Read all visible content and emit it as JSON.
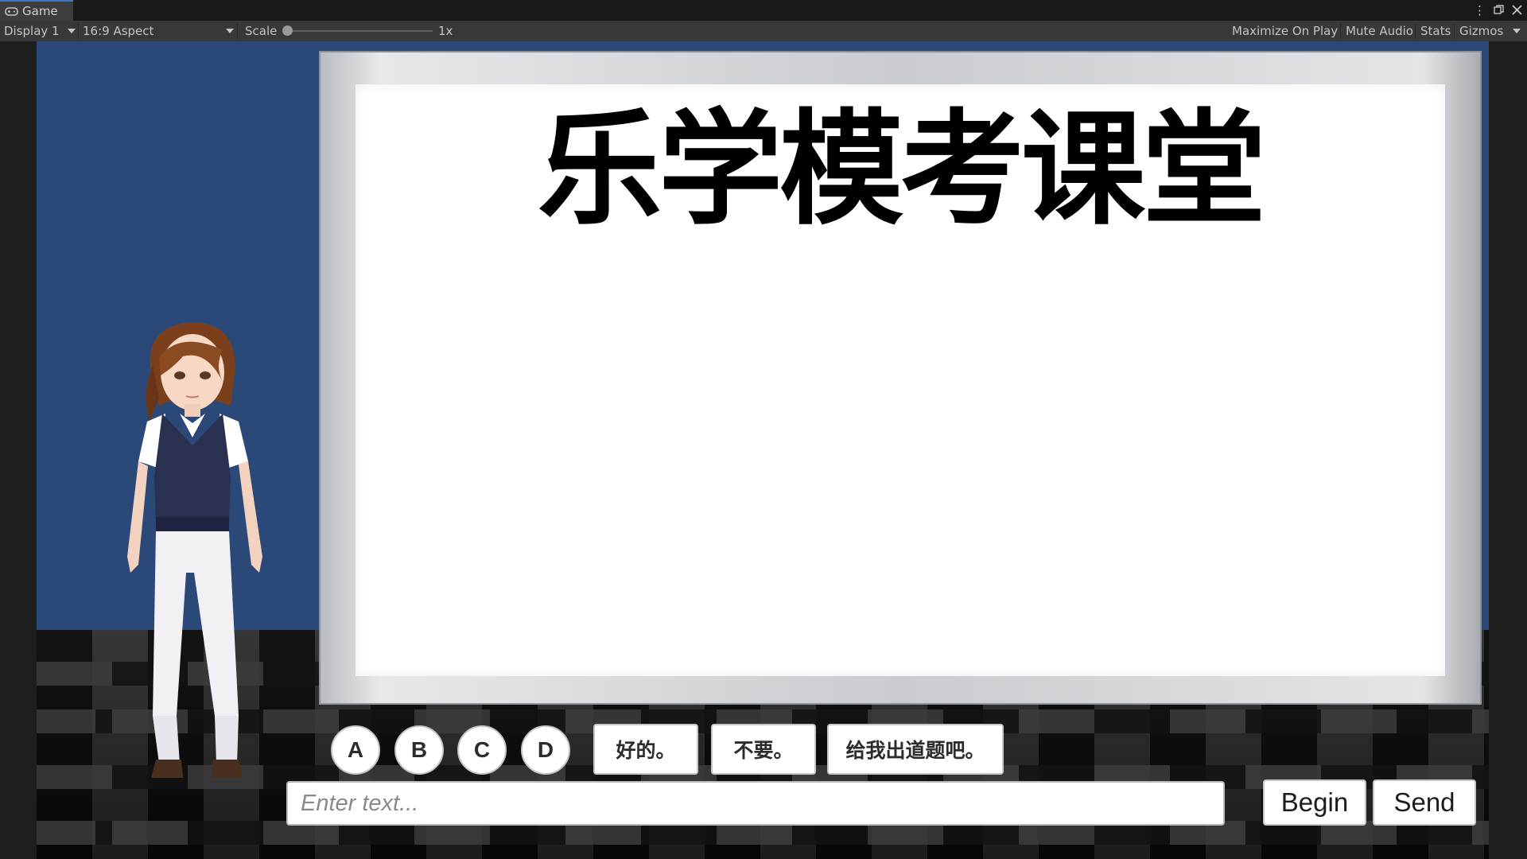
{
  "window": {
    "tab_title": "Game",
    "tab_icon": "gamepad-icon",
    "window_controls": [
      "kebab-menu-icon",
      "maximize-icon",
      "close-icon"
    ]
  },
  "toolbar": {
    "display": "Display 1",
    "aspect": "16:9 Aspect",
    "scale_label": "Scale",
    "scale_value": "1x",
    "maximize_on_play": "Maximize On Play",
    "mute_audio": "Mute Audio",
    "stats": "Stats",
    "gizmos": "Gizmos"
  },
  "scene": {
    "background_color": "#2b4978",
    "whiteboard_title": "乐学模考课堂"
  },
  "controls": {
    "answer_options": [
      "A",
      "B",
      "C",
      "D"
    ],
    "quick_replies": [
      "好的。",
      "不要。",
      "给我出道题吧。"
    ],
    "input_placeholder": "Enter text...",
    "begin_label": "Begin",
    "send_label": "Send"
  }
}
